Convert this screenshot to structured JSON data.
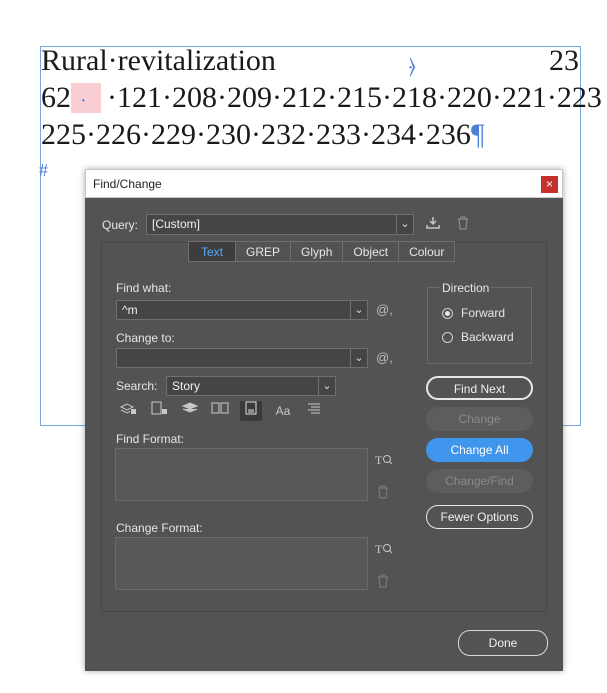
{
  "document": {
    "line1": "Rural·revitalization",
    "line1_right": "23",
    "line2_start": "62",
    "line2_rest": "·121·208·209·212·215·218·220·221·223",
    "line3": "225·226·229·230·232·233·234·236",
    "pilcrow": "¶",
    "hash": "#",
    "anchor": "⦒"
  },
  "dialog": {
    "title": "Find/Change",
    "close_glyph": "×",
    "query_label": "Query:",
    "query_value": "[Custom]",
    "tabs": [
      {
        "label": "Text",
        "active": true
      },
      {
        "label": "GREP",
        "active": false
      },
      {
        "label": "Glyph",
        "active": false
      },
      {
        "label": "Object",
        "active": false
      },
      {
        "label": "Colour",
        "active": false
      }
    ],
    "find_label": "Find what:",
    "find_value": "^m",
    "change_label": "Change to:",
    "change_value": "",
    "special_chars_glyph": "@,",
    "search_label": "Search:",
    "search_value": "Story",
    "find_format_label": "Find Format:",
    "change_format_label": "Change Format:",
    "direction_label": "Direction",
    "direction_forward": "Forward",
    "direction_backward": "Backward",
    "direction_selected": "Forward",
    "buttons": {
      "find_next": "Find Next",
      "change": "Change",
      "change_all": "Change All",
      "change_find": "Change/Find",
      "fewer_options": "Fewer Options",
      "done": "Done"
    },
    "tools": [
      "lock-layers-icon",
      "lock-stories-icon",
      "hidden-layers-icon",
      "master-pages-icon",
      "footnotes-icon",
      "case-sensitive-icon",
      "whole-word-icon"
    ],
    "case_sensitive_glyph": "Aa",
    "colors": {
      "accent": "#3f96ec",
      "dialog_bg": "#535353",
      "active_tab_text": "#5aa9f5",
      "close": "#c4302b"
    }
  }
}
